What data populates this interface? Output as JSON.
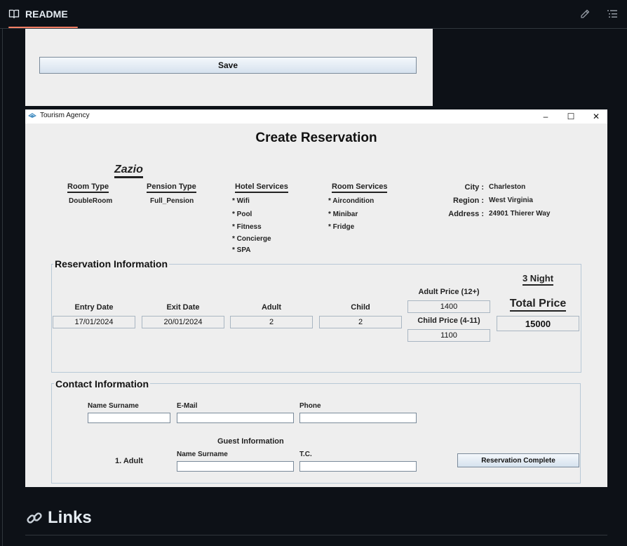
{
  "readme": {
    "tab_label": "README",
    "icon_book": "book-icon",
    "icon_edit": "pencil-icon",
    "icon_outline": "list-icon"
  },
  "save_panel": {
    "save_label": "Save"
  },
  "window": {
    "title": "Tourism Agency",
    "controls": {
      "minimize": "–",
      "maximize": "☐",
      "close": "✕"
    },
    "heading": "Create Reservation",
    "hotel_name": "Zazio",
    "room_type": {
      "label": "Room Type",
      "value": "DoubleRoom"
    },
    "pension_type": {
      "label": "Pension Type",
      "value": "Full_Pension"
    },
    "hotel_services": {
      "label": "Hotel Services",
      "items": [
        "* Wifi",
        "* Pool",
        "* Fitness",
        "* Concierge",
        "* SPA"
      ]
    },
    "room_services": {
      "label": "Room Services",
      "items": [
        "* Aircondition",
        "* Minibar",
        "* Fridge"
      ]
    },
    "city": {
      "label": "City :",
      "value": "Charleston"
    },
    "region": {
      "label": "Region :",
      "value": "West Virginia"
    },
    "address": {
      "label": "Address :",
      "value": "24901 Thierer Way"
    },
    "reservation": {
      "title": "Reservation Information",
      "entry_date": {
        "label": "Entry Date",
        "value": "17/01/2024"
      },
      "exit_date": {
        "label": "Exit Date",
        "value": "20/01/2024"
      },
      "adult": {
        "label": "Adult",
        "value": "2"
      },
      "child": {
        "label": "Child",
        "value": "2"
      },
      "adult_price": {
        "label": "Adult Price (12+)",
        "value": "1400"
      },
      "child_price": {
        "label": "Child Price (4-11)",
        "value": "1100"
      },
      "nights": "3 Night",
      "total_price": {
        "label": "Total Price",
        "value": "15000"
      }
    },
    "contact": {
      "title": "Contact Information",
      "name_label": "Name Surname",
      "email_label": "E-Mail",
      "phone_label": "Phone",
      "guest_title": "Guest Information",
      "guest_row": "1. Adult",
      "guest_name_label": "Name Surname",
      "tc_label": "T.C.",
      "complete_button": "Reservation Complete"
    }
  },
  "links": {
    "icon": "link-icon",
    "title": "Links"
  }
}
